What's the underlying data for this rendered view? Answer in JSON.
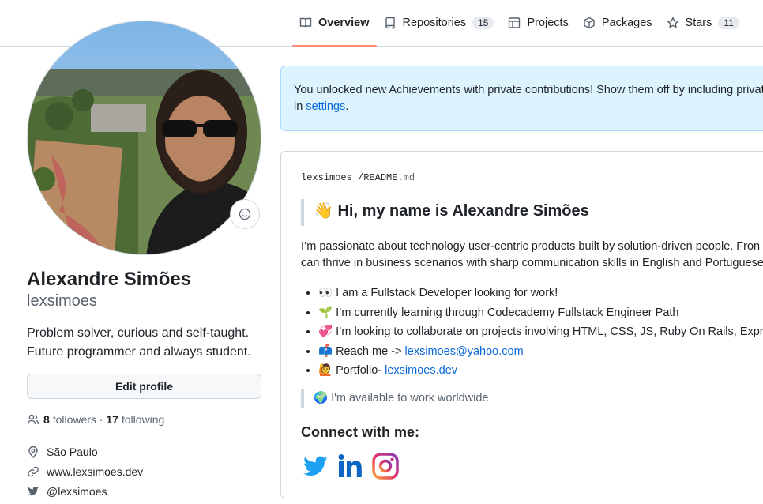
{
  "tabs": [
    {
      "label": "Overview",
      "icon": "book-icon",
      "active": true
    },
    {
      "label": "Repositories",
      "icon": "repo-icon",
      "count": "15"
    },
    {
      "label": "Projects",
      "icon": "table-icon"
    },
    {
      "label": "Packages",
      "icon": "package-icon"
    },
    {
      "label": "Stars",
      "icon": "star-icon",
      "count": "11"
    }
  ],
  "profile": {
    "full_name": "Alexandre Simões",
    "username": "lexsimoes",
    "bio_line1": "Problem solver, curious and self-taught.",
    "bio_line2": "Future programmer and always student.",
    "edit_label": "Edit profile",
    "followers_count": "8",
    "followers_label": "followers",
    "separator": "·",
    "following_count": "17",
    "following_label": "following",
    "location": "São Paulo",
    "website": "www.lexsimoes.dev",
    "twitter": "@lexsimoes"
  },
  "banner": {
    "text": "You unlocked new Achievements with private contributions! Show them off by including privat",
    "text2": "in",
    "link": "settings",
    "tail": "."
  },
  "readme": {
    "owner": "lexsimoes",
    "slash": "/",
    "file": "README",
    "ext": ".md",
    "heading": "👋 Hi, my name is Alexandre Simões",
    "intro1": "I’m passionate about technology user-centric products built by solution-driven people. Fron",
    "intro2": "can thrive in business scenarios with sharp communication skills in English and Portuguese",
    "bullets": [
      {
        "text": "👀 I am a Fullstack Developer looking for work!"
      },
      {
        "text": "🌱 I’m currently learning through Codecademy Fullstack Engineer Path"
      },
      {
        "text": "💞️ I’m looking to collaborate on projects involving HTML, CSS, JS, Ruby On Rails, Expre"
      },
      {
        "text": "📫 Reach me ->",
        "link": "lexsimoes@yahoo.com"
      },
      {
        "text": "🙋 Portfolio-",
        "link": "lexsimoes.dev"
      }
    ],
    "available": "🌍 I'm available to work worldwide",
    "connect_heading": "Connect with me:"
  },
  "colors": {
    "accent": "#fd8c73",
    "link": "#0969da",
    "banner_bg": "#ddf4ff",
    "twitter": "#1da1f2",
    "linkedin": "#0a66c2"
  }
}
